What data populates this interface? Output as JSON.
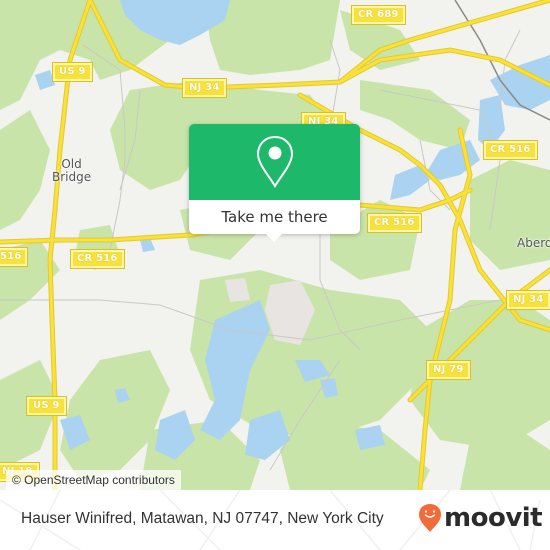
{
  "map": {
    "colors": {
      "land": "#f2f2ef",
      "forest": "#c9e4a9",
      "water": "#a9d3f0",
      "highway": "#f7e13a",
      "minor_road": "#bcbcbc",
      "rail": "#888888"
    },
    "shields": [
      {
        "id": "cr689",
        "label": "CR 689"
      },
      {
        "id": "us9-top",
        "label": "US 9"
      },
      {
        "id": "nj34-top",
        "label": "NJ 34"
      },
      {
        "id": "nj34-mid",
        "label": "NJ 34"
      },
      {
        "id": "cr516-east",
        "label": "CR 516"
      },
      {
        "id": "cr516-center",
        "label": "CR 516"
      },
      {
        "id": "cr516-west",
        "label": "516"
      },
      {
        "id": "cr516-right",
        "label": "CR 516"
      },
      {
        "id": "nj34-right",
        "label": "NJ 34"
      },
      {
        "id": "nj79",
        "label": "NJ 79"
      },
      {
        "id": "us9-bottom",
        "label": "US 9"
      },
      {
        "id": "nj18-bottom",
        "label": "NJ 18"
      }
    ],
    "places": [
      {
        "id": "old-bridge",
        "label": "Old\nBridge"
      },
      {
        "id": "aberdeen",
        "label": "Aberd"
      }
    ],
    "attribution": "© OpenStreetMap contributors"
  },
  "popup": {
    "pin_icon": "map-pin-icon",
    "cta_label": "Take me there",
    "accent": "#1eb86b"
  },
  "footer": {
    "address": "Hauser Winifred, Matawan, NJ 07747, New York City",
    "brand_name": "moovit",
    "brand_color": "#f26b3a"
  }
}
